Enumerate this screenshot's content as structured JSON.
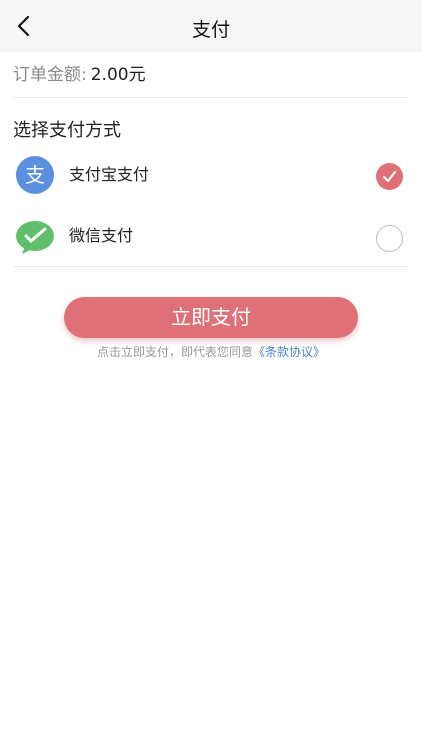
{
  "header": {
    "title": "支付",
    "back_icon": "chevron-left-icon"
  },
  "order": {
    "label": "订单金额:",
    "amount": "2.00元"
  },
  "payment": {
    "section_title": "选择支付方式",
    "methods": [
      {
        "label": "支付宝支付",
        "icon": "alipay-icon",
        "color": "#5b8fe0",
        "selected": true
      },
      {
        "label": "微信支付",
        "icon": "wechat-pay-icon",
        "color": "#5fbf6b",
        "selected": false
      }
    ]
  },
  "actions": {
    "pay_label": "立即支付"
  },
  "agreement": {
    "text": "点击立即支付，即代表您同意",
    "link": "《条款协议》"
  },
  "colors": {
    "accent": "#e07078",
    "link": "#4a86c8"
  }
}
